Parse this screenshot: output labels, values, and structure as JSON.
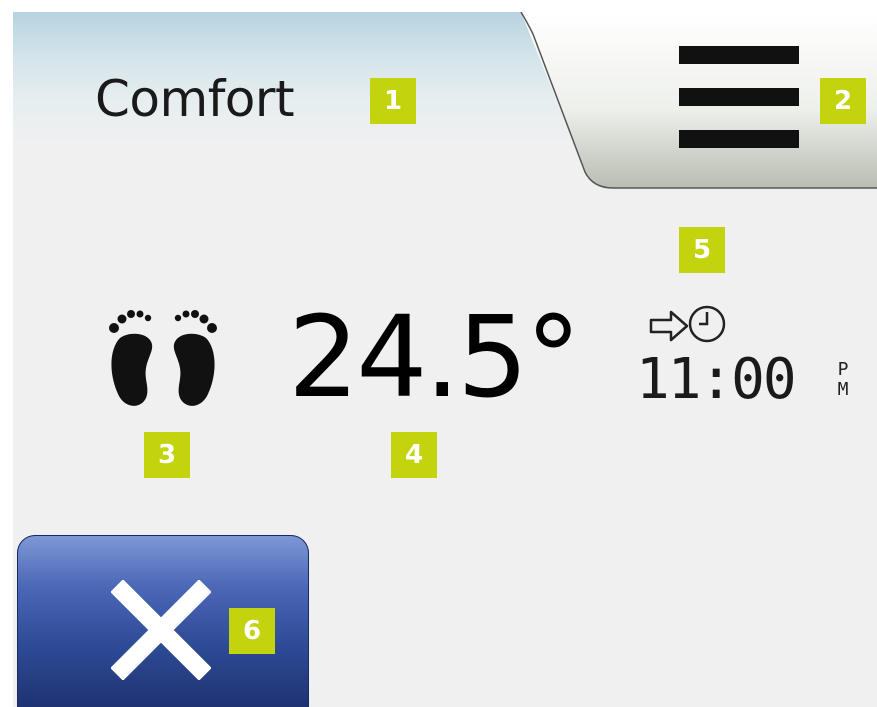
{
  "header": {
    "mode_title": "Comfort",
    "badge_1": "1",
    "badge_2": "2"
  },
  "main": {
    "mode_icon": "feet-icon",
    "temperature": "24.5°",
    "badge_3": "3",
    "badge_4": "4",
    "badge_5": "5",
    "next_change": {
      "icon": "arrow-clock-icon",
      "time": "11:00",
      "ampm_top": "P",
      "ampm_bottom": "M"
    }
  },
  "footer": {
    "cancel_icon": "close-icon",
    "badge_6": "6"
  },
  "colors": {
    "badge": "#c3d40e",
    "button_blue": "#2f4c98",
    "background": "#f0f0f0"
  }
}
